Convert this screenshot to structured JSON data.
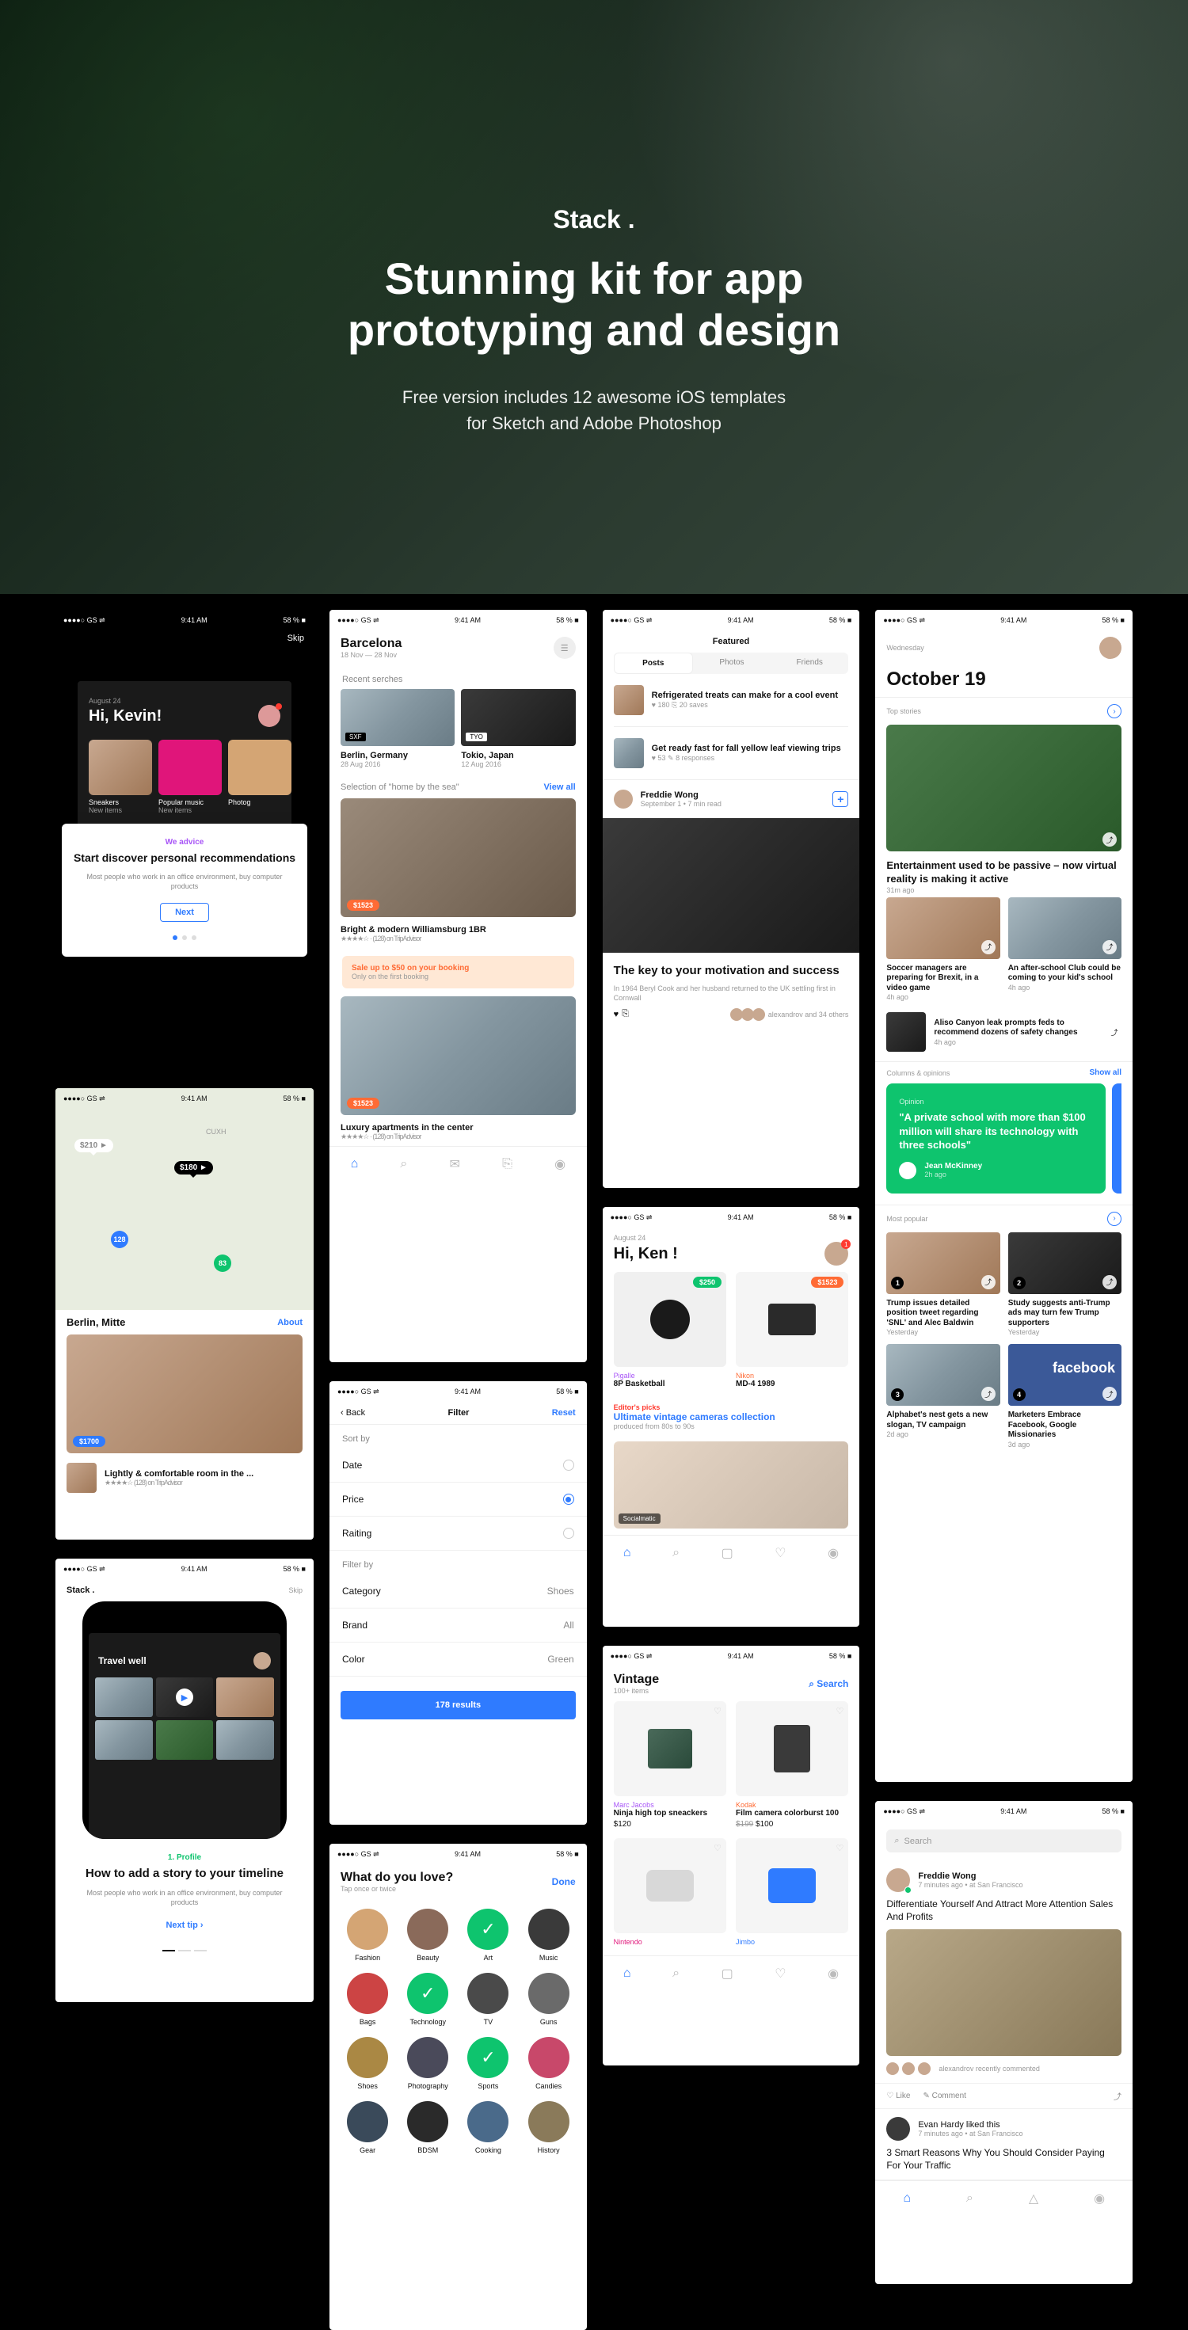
{
  "hero": {
    "logo": "Stack .",
    "title": "Stunning kit for app prototyping and design",
    "sub1": "Free version includes 12 awesome iOS templates",
    "sub2": "for Sketch and Adobe Photoshop"
  },
  "status": {
    "signal": "●●●●○ GS ⇌",
    "time": "9:41 AM",
    "batt": "58 % ■"
  },
  "s1": {
    "skip": "Skip",
    "date": "August 24",
    "greet": "Hi, Kevin!",
    "cats": [
      "Sneakers",
      "Popular music",
      "Photog"
    ],
    "cat_sub": "New items",
    "modal_tag": "We advice",
    "modal_title": "Start discover personal recommendations",
    "modal_body": "Most people who work in an office environment, buy computer products",
    "next": "Next"
  },
  "s2": {
    "loc": "Berlin, Mitte",
    "about": "About",
    "markers": {
      "a": "$210 ►",
      "b": "$180 ►",
      "c": "CUXH",
      "d": "128",
      "e": "83"
    },
    "price": "$1700",
    "room": "Lightly & comfortable room in the ...",
    "room_sub": "★★★★☆ (128) on TripAdvisor"
  },
  "s3": {
    "brand": "Stack .",
    "skip": "Skip",
    "tag": "1. Profile",
    "title": "How to add a story to your timeline",
    "body": "Most people who work in an office environment, buy computer products",
    "cta": "Next tip ›"
  },
  "s4": {
    "city": "Barcelona",
    "dates": "18 Nov — 28 Nov",
    "recent": "Recent serches",
    "d1": "Berlin, Germany",
    "d1s": "28 Aug 2016",
    "d1b": "SXF",
    "d2": "Tokio, Japan",
    "d2s": "12 Aug 2016",
    "d2b": "TYO",
    "sel": "Selection of \"home by the sea\"",
    "viewall": "View all",
    "p1": "$1523",
    "l1": "Bright & modern Williamsburg 1BR",
    "l1s": "★★★★☆ · (128) on TripAdvisor",
    "promo_t": "Sale up to $50 on your booking",
    "promo_s": "Only on the first booking",
    "p2": "$1523",
    "l2": "Luxury apartments in the center",
    "l2s": "★★★★☆ · (128) on TripAdvisor"
  },
  "s5": {
    "back": "‹ Back",
    "title": "Filter",
    "reset": "Reset",
    "sortby": "Sort by",
    "rows": [
      "Date",
      "Price",
      "Raiting"
    ],
    "filterby": "Filter by",
    "cat": "Category",
    "cat_v": "Shoes",
    "brand": "Brand",
    "brand_v": "All",
    "color": "Color",
    "color_v": "Green",
    "cta": "178 results"
  },
  "s6": {
    "title": "What do you love?",
    "sub": "Tap once or twice",
    "done": "Done",
    "cats": [
      "Fashion",
      "Beauty",
      "Art",
      "Music",
      "Bags",
      "Technology",
      "TV",
      "Guns",
      "Shoes",
      "Photography",
      "Sports",
      "Candies",
      "Gear",
      "BDSM",
      "Cooking",
      "History"
    ],
    "selected": [
      2,
      5,
      10
    ]
  },
  "s7": {
    "title": "Featured",
    "tabs": [
      "Posts",
      "Photos",
      "Friends"
    ],
    "a1": "Refrigerated treats can make for a cool event",
    "a1s": "♥ 180   ⎘ 20 saves",
    "a2": "Get ready fast for fall yellow leaf viewing trips",
    "a2s": "♥ 53   ✎ 8 responses",
    "author": "Freddie Wong",
    "auth_sub": "September 1 • 7 min read",
    "add": "+",
    "big_t": "The key to your motivation and success",
    "big_b": "In 1964 Beryl Cook and her husband returned to the UK settling first in Cornwall",
    "soc": "alexandrov and 34 others"
  },
  "s8": {
    "date": "August 24",
    "greet": "Hi, Ken !",
    "p1": "$250",
    "p2": "$1523",
    "b1": "Pigalle",
    "n1": "8P Basketball",
    "b2": "Nikon",
    "n2": "MD-4 1989",
    "ed": "Editor's picks",
    "ed_t": "Ultimate vintage cameras collection",
    "ed_s": "produced from 80s to 90s"
  },
  "s9": {
    "title": "Vintage",
    "sub": "100+ items",
    "search": "⌕ Search",
    "b1": "Marc Jacobs",
    "n1": "Ninja high top sneackers",
    "pr1": "$120",
    "b2": "Kodak",
    "n2": "Film camera colorburst 100",
    "pr2": "$199 $100",
    "b3": "Nintendo",
    "b4": "Jimbo"
  },
  "s10": {
    "day": "Wednesday",
    "date": "October 19",
    "top": "Top stories",
    "h1": "Entertainment used to be passive – now virtual reality is making it active",
    "h1s": "31m ago",
    "c1": "Soccer managers are preparing for Brexit, in a video game",
    "c1s": "4h ago",
    "c2": "An after-school Club could be coming to your kid's school",
    "c2s": "4h ago",
    "c3": "Aliso Canyon leak prompts feds to recommend dozens of safety changes",
    "c3s": "4h ago",
    "co": "Columns & opinions",
    "showall": "Show all",
    "op_tag": "Opinion",
    "op": "\"A private school with more than $100 million will share its technology with three schools\"",
    "op_a": "Jean McKinney",
    "op_as": "2h ago",
    "mp": "Most popular",
    "m1": "Trump issues detailed position tweet regarding 'SNL' and Alec Baldwin",
    "m1s": "Yesterday",
    "m2": "Study suggests anti-Trump ads may turn few Trump supporters",
    "m2s": "Yesterday",
    "m3": "Alphabet's nest gets a new slogan, TV campaign",
    "m3s": "2d ago",
    "m4": "Marketers Embrace Facebook, Google Missionaries",
    "m4s": "3d ago"
  },
  "s11": {
    "search": "Search",
    "u1": "Freddie Wong",
    "u1s": "7 minutes ago • at San Francisco",
    "p1": "Differentiate Yourself And Attract More Attention Sales And Profits",
    "soc": "alexandrov recently commented",
    "like": "♡ Like",
    "comment": "✎ Comment",
    "u2": "Evan Hardy liked this",
    "u2s": "7 minutes ago • at San Francisco",
    "p2": "3 Smart Reasons Why You Should Consider Paying For Your Traffic"
  }
}
